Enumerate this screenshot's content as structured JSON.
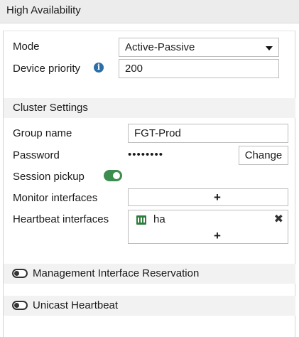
{
  "header": {
    "title": "High Availability"
  },
  "mode": {
    "label": "Mode",
    "value": "Active-Passive"
  },
  "device_priority": {
    "label": "Device priority",
    "value": "200",
    "info_icon": "info-icon"
  },
  "cluster_settings": {
    "title": "Cluster Settings",
    "group_name": {
      "label": "Group name",
      "value": "FGT-Prod"
    },
    "password": {
      "label": "Password",
      "masked": "••••••••",
      "change_label": "Change"
    },
    "session_pickup": {
      "label": "Session pickup",
      "enabled": true
    },
    "monitor_interfaces": {
      "label": "Monitor interfaces",
      "add_symbol": "+"
    },
    "heartbeat_interfaces": {
      "label": "Heartbeat interfaces",
      "items": [
        {
          "name": "ha",
          "icon": "port-icon"
        }
      ],
      "add_symbol": "+",
      "remove_symbol": "✖"
    }
  },
  "management_interface_reservation": {
    "label": "Management Interface Reservation",
    "enabled": false
  },
  "unicast_heartbeat": {
    "label": "Unicast Heartbeat",
    "enabled": false
  },
  "colors": {
    "toggle_on": "#3c8d4f",
    "info": "#2c6ea6",
    "port": "#2f7d3c"
  }
}
